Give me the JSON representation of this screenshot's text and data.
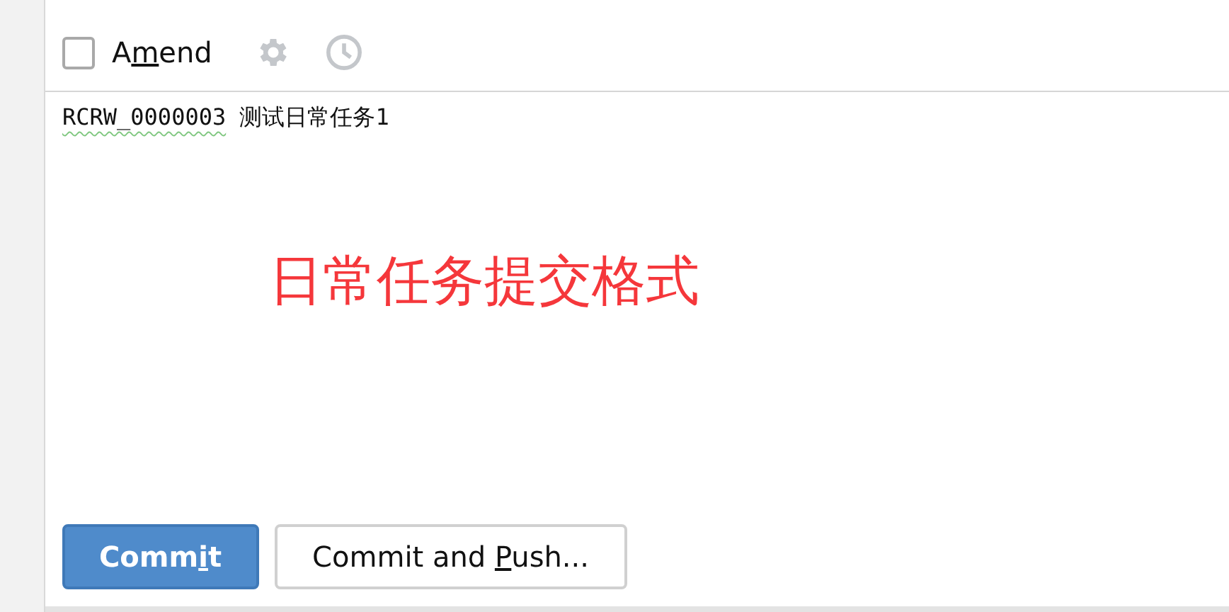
{
  "toolbar": {
    "amend": {
      "label": {
        "before": "A",
        "mnemonic": "m",
        "after": "end"
      },
      "checked": false
    }
  },
  "message": {
    "value": "RCRW_0000003 测试日常任务1"
  },
  "annotation": {
    "text": "日常任务提交格式"
  },
  "buttons": [
    {
      "label": {
        "before": "Comm",
        "mnemonic": "i",
        "after": "t"
      },
      "kind": "primary"
    },
    {
      "label": {
        "before": "Commit and ",
        "mnemonic": "P",
        "after": "ush..."
      },
      "kind": "secondary"
    }
  ]
}
